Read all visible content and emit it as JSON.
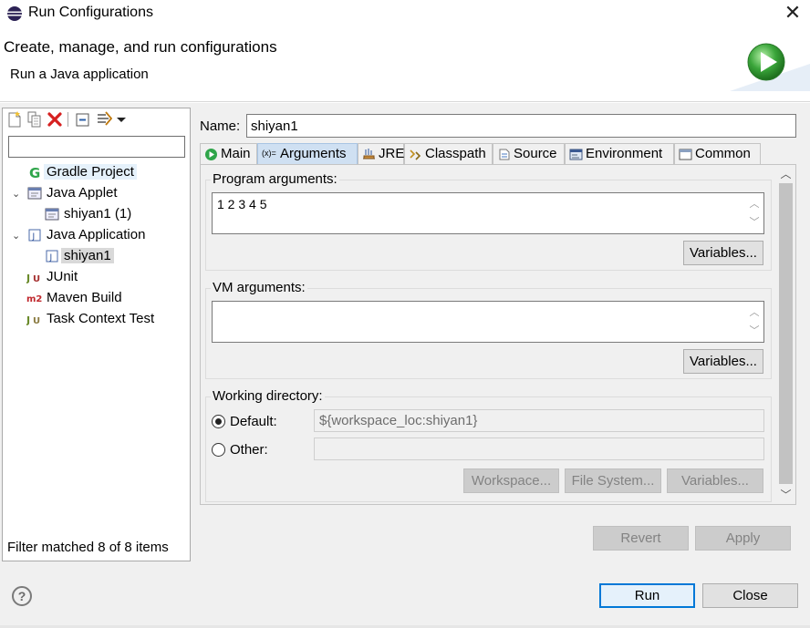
{
  "window": {
    "title": "Run Configurations",
    "close_glyph": "✕"
  },
  "header": {
    "title": "Create, manage, and run configurations",
    "subtitle": "Run a Java application"
  },
  "left": {
    "filter_value": "",
    "tree": [
      {
        "label": "Gradle Project",
        "icon": "gradle-icon"
      },
      {
        "label": "Java Applet",
        "icon": "java-applet-icon",
        "expanded": true
      },
      {
        "label": "shiyan1 (1)",
        "icon": "applet-config-icon"
      },
      {
        "label": "Java Application",
        "icon": "java-application-icon",
        "expanded": true
      },
      {
        "label": "shiyan1",
        "icon": "java-config-icon",
        "selected": true
      },
      {
        "label": "JUnit",
        "icon": "junit-icon"
      },
      {
        "label": "Maven Build",
        "icon": "maven-icon"
      },
      {
        "label": "Task Context Test",
        "icon": "task-context-icon"
      }
    ],
    "status": "Filter matched 8 of 8 items"
  },
  "config": {
    "name_label": "Name:",
    "name_value": "shiyan1",
    "tabs": [
      {
        "label": "Main",
        "icon": "main-tab-icon"
      },
      {
        "label": "Arguments",
        "icon": "arguments-tab-icon",
        "active": true
      },
      {
        "label": "JRE",
        "icon": "jre-tab-icon"
      },
      {
        "label": "Classpath",
        "icon": "classpath-tab-icon"
      },
      {
        "label": "Source",
        "icon": "source-tab-icon"
      },
      {
        "label": "Environment",
        "icon": "environment-tab-icon"
      },
      {
        "label": "Common",
        "icon": "common-tab-icon"
      }
    ],
    "arguments_icon_text": "(x)=",
    "program_args": {
      "title": "Program arguments:",
      "value": "1 2 3 4 5",
      "variables_label": "Variables..."
    },
    "vm_args": {
      "title": "VM arguments:",
      "value": "",
      "variables_label": "Variables..."
    },
    "working_dir": {
      "title": "Working directory:",
      "default_label": "Default:",
      "default_value": "${workspace_loc:shiyan1}",
      "other_label": "Other:",
      "other_value": "",
      "workspace_label": "Workspace...",
      "filesystem_label": "File System...",
      "variables_label": "Variables..."
    },
    "revert_label": "Revert",
    "apply_label": "Apply"
  },
  "footer": {
    "help_glyph": "?",
    "run_label": "Run",
    "close_label": "Close"
  },
  "colors": {
    "accent": "#0078d7",
    "selection": "#e5f1fb",
    "active_tab": "#cfe0f2",
    "run_green": "#3aa53a"
  }
}
